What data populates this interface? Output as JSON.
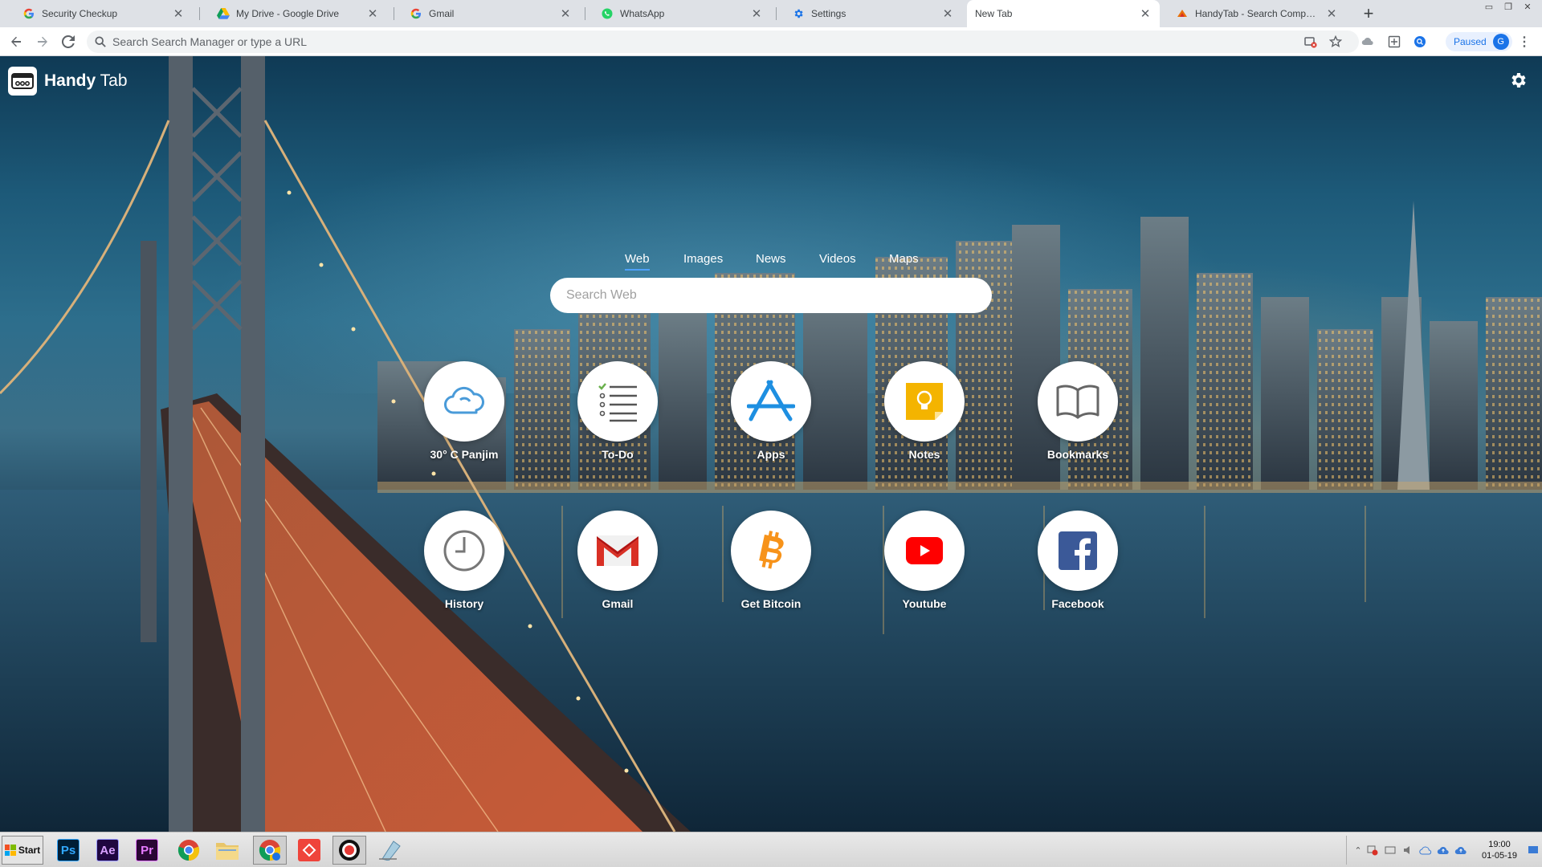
{
  "browser": {
    "tabs": [
      {
        "title": "Security Checkup",
        "icon": "google-g-icon",
        "active": false
      },
      {
        "title": "My Drive - Google Drive",
        "icon": "google-drive-icon",
        "active": false
      },
      {
        "title": "Gmail",
        "icon": "google-g-icon",
        "active": false
      },
      {
        "title": "WhatsApp",
        "icon": "whatsapp-icon",
        "active": false
      },
      {
        "title": "Settings",
        "icon": "gear-icon",
        "active": false
      },
      {
        "title": "New Tab",
        "icon": "",
        "active": true
      },
      {
        "title": "HandyTab - Search Companion - Ch",
        "icon": "handytab-icon",
        "active": false
      }
    ],
    "omnibox_placeholder": "Search Search Manager or type a URL",
    "profile_status": "Paused",
    "profile_initial": "G"
  },
  "page": {
    "brand_bold": "Handy",
    "brand_rest": " Tab",
    "search_tabs": [
      "Web",
      "Images",
      "News",
      "Videos",
      "Maps"
    ],
    "active_search_tab": "Web",
    "search_placeholder": "Search Web",
    "tiles": [
      {
        "label": "30° C Panjim",
        "icon": "cloud-icon"
      },
      {
        "label": "To-Do",
        "icon": "checklist-icon"
      },
      {
        "label": "Apps",
        "icon": "app-store-icon"
      },
      {
        "label": "Notes",
        "icon": "lightbulb-note-icon"
      },
      {
        "label": "Bookmarks",
        "icon": "open-book-icon"
      },
      {
        "label": "History",
        "icon": "clock-icon"
      },
      {
        "label": "Gmail",
        "icon": "gmail-icon"
      },
      {
        "label": "Get Bitcoin",
        "icon": "bitcoin-icon"
      },
      {
        "label": "Youtube",
        "icon": "youtube-icon"
      },
      {
        "label": "Facebook",
        "icon": "facebook-icon"
      }
    ]
  },
  "taskbar": {
    "start_label": "Start",
    "apps": [
      {
        "name": "photoshop",
        "text": "Ps"
      },
      {
        "name": "after-effects",
        "text": "Ae"
      },
      {
        "name": "premiere",
        "text": "Pr"
      },
      {
        "name": "chrome",
        "text": ""
      },
      {
        "name": "file-explorer",
        "text": ""
      },
      {
        "name": "chrome-profile",
        "text": ""
      },
      {
        "name": "anydesk",
        "text": ""
      },
      {
        "name": "screen-recorder",
        "text": ""
      },
      {
        "name": "eraser-app",
        "text": ""
      }
    ],
    "clock_time": "19:00",
    "clock_date": "01-05-19"
  },
  "colors": {
    "accent": "#4ea1ff",
    "chrome_bg": "#dee1e6",
    "youtube_red": "#ff0000",
    "facebook_blue": "#3b5998",
    "bitcoin_orange": "#f7931a",
    "notes_yellow": "#f4b400"
  }
}
